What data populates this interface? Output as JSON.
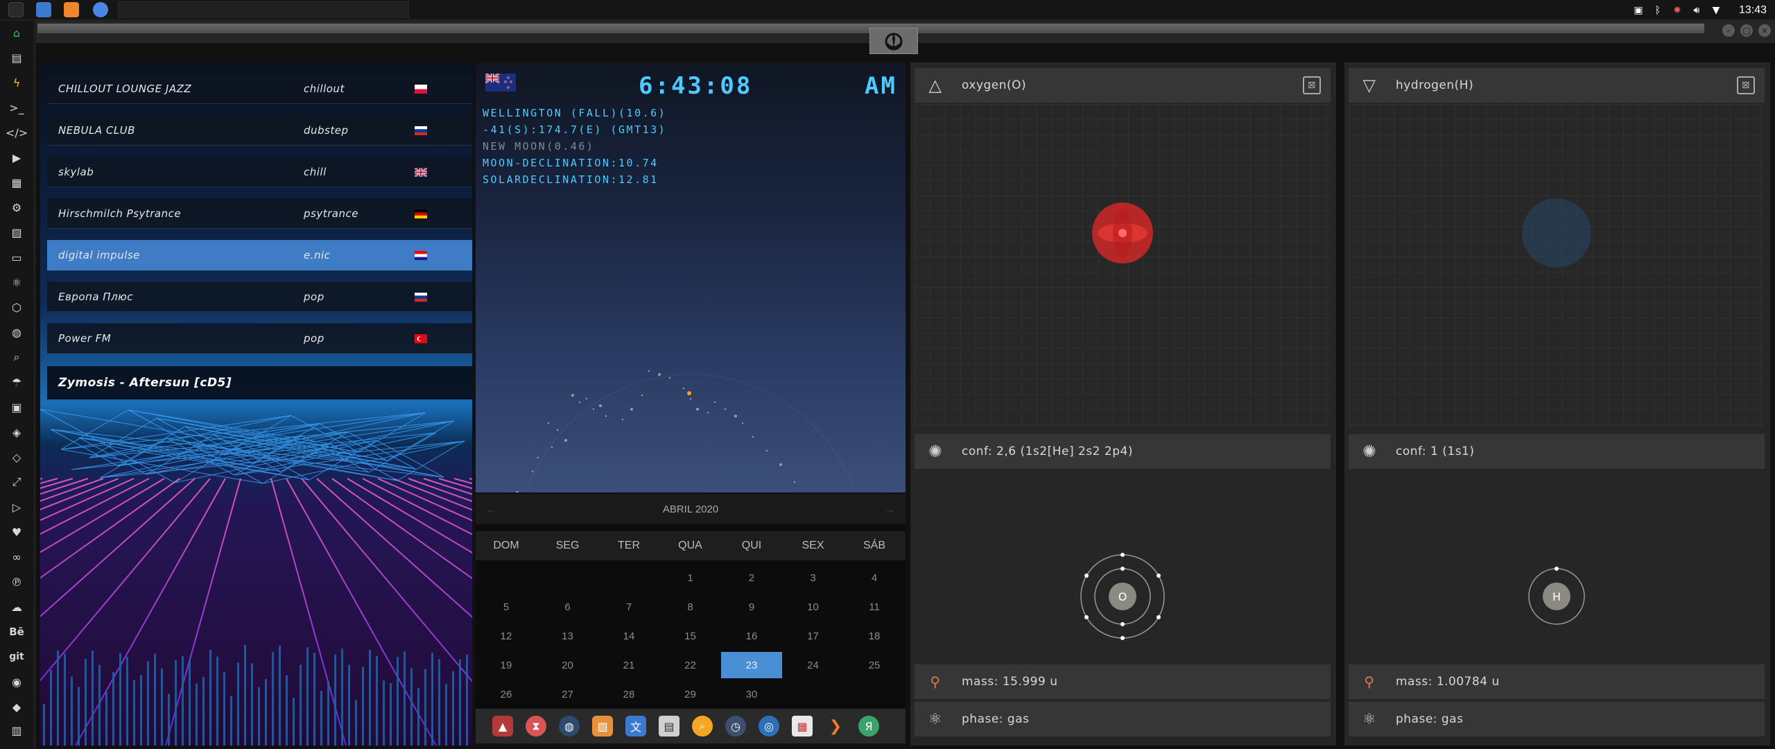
{
  "clock": "13:43",
  "radio": {
    "stations": [
      {
        "name": "CHILLOUT LOUNGE JAZZ",
        "genre": "chillout",
        "flag": "poland"
      },
      {
        "name": "NEBULA CLUB",
        "genre": "dubstep",
        "flag": "russia"
      },
      {
        "name": "skylab",
        "genre": "chill",
        "flag": "united-kingdom"
      },
      {
        "name": "Hirschmilch Psytrance",
        "genre": "psytrance",
        "flag": "germany"
      },
      {
        "name": "digital impulse",
        "genre": "e.nic",
        "flag": "croatia"
      },
      {
        "name": "Европа Плюс",
        "genre": "pop",
        "flag": "russia"
      },
      {
        "name": "Power FM",
        "genre": "pop",
        "flag": "turkey"
      }
    ],
    "active_index": 4,
    "now_playing": "Zymosis - Aftersun [cD5]"
  },
  "world_clock": {
    "time": "6:43:08",
    "ampm": "AM",
    "lines": [
      {
        "text": "WELLINGTON (FALL)(10.6)",
        "color": "#4fc9ff"
      },
      {
        "text": "-41(S):174.7(E) (GMT13)",
        "color": "#4fc9ff"
      },
      {
        "text": "NEW MOON(0.46)",
        "color": "#7d8a99"
      },
      {
        "text": "MOON-DECLINATION:10.74",
        "color": "#4fc9ff"
      },
      {
        "text": "SOLARDECLINATION:12.81",
        "color": "#4fc9ff"
      }
    ]
  },
  "calendar": {
    "month_label": "ABRIL 2020",
    "prev": "←",
    "next": "→",
    "day_names": [
      "DOM",
      "SEG",
      "TER",
      "QUA",
      "QUI",
      "SEX",
      "SÁB"
    ],
    "weeks": [
      [
        "",
        "",
        "",
        "1",
        "2",
        "3",
        "4"
      ],
      [
        "5",
        "6",
        "7",
        "8",
        "9",
        "10",
        "11"
      ],
      [
        "12",
        "13",
        "14",
        "15",
        "16",
        "17",
        "18"
      ],
      [
        "19",
        "20",
        "21",
        "22",
        "23",
        "24",
        "25"
      ],
      [
        "26",
        "27",
        "28",
        "29",
        "30",
        "",
        ""
      ]
    ],
    "today": "23"
  },
  "elements": [
    {
      "title": "oxygen(O)",
      "symbol": "O",
      "conf": "conf: 2,6 (1s2[He] 2s2 2p4)",
      "mass": "mass: 15.999 u",
      "phase": "phase: gas",
      "orbital_color": "#c62828"
    },
    {
      "title": "hydrogen(H)",
      "symbol": "H",
      "conf": "conf: 1 (1s1)",
      "mass": "mass: 1.00784 u",
      "phase": "phase: gas",
      "orbital_color": "#2a4a70"
    }
  ]
}
